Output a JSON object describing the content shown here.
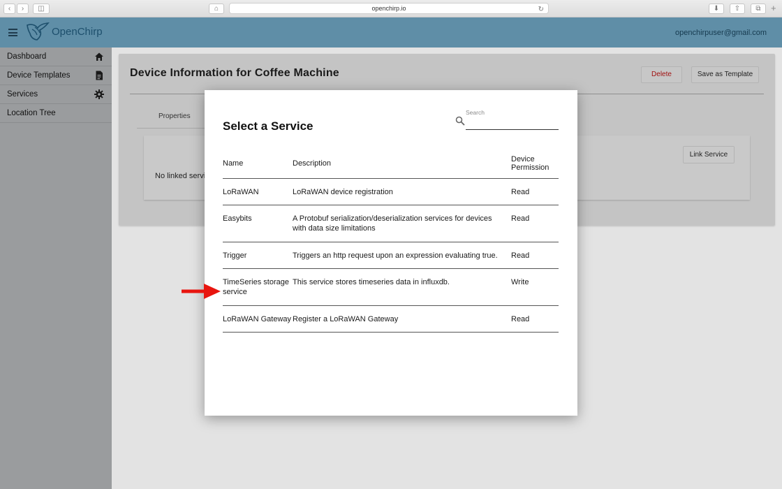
{
  "browser": {
    "url": "openchirp.io"
  },
  "header": {
    "brand": "OpenChirp",
    "user_email": "openchirpuser@gmail.com"
  },
  "sidebar": {
    "items": [
      {
        "label": "Dashboard",
        "icon": "home-icon"
      },
      {
        "label": "Device Templates",
        "icon": "document-icon"
      },
      {
        "label": "Services",
        "icon": "gear-icon"
      },
      {
        "label": "Location Tree",
        "icon": ""
      }
    ]
  },
  "page": {
    "title": "Device Information for Coffee Machine",
    "delete_label": "Delete",
    "save_template_label": "Save as Template",
    "tab_properties": "Properties",
    "no_linked_text": "No linked servi",
    "link_service_label": "Link Service"
  },
  "modal": {
    "title": "Select a Service",
    "search_label": "Search",
    "search_value": "",
    "columns": {
      "name": "Name",
      "description": "Description",
      "permission_line1": "Device",
      "permission_line2": "Permission"
    },
    "rows": [
      {
        "name": "LoRaWAN",
        "description": "LoRaWAN device registration",
        "permission": "Read"
      },
      {
        "name": "Easybits",
        "description": "A Protobuf serialization/deserialization services for devices with data size limitations",
        "permission": "Read"
      },
      {
        "name": "Trigger",
        "description": "Triggers an http request upon an expression evaluating true.",
        "permission": "Read"
      },
      {
        "name": "TimeSeries storage service",
        "description": "This service stores timeseries data in influxdb.",
        "permission": "Write"
      },
      {
        "name": "LoRaWAN Gateway",
        "description": "Register a LoRaWAN Gateway",
        "permission": "Read"
      }
    ]
  },
  "colors": {
    "appbar": "#5f8ea7",
    "sidebar": "#9a9c9e",
    "delete_text": "#a01010",
    "annotation_arrow": "#e8150f"
  }
}
